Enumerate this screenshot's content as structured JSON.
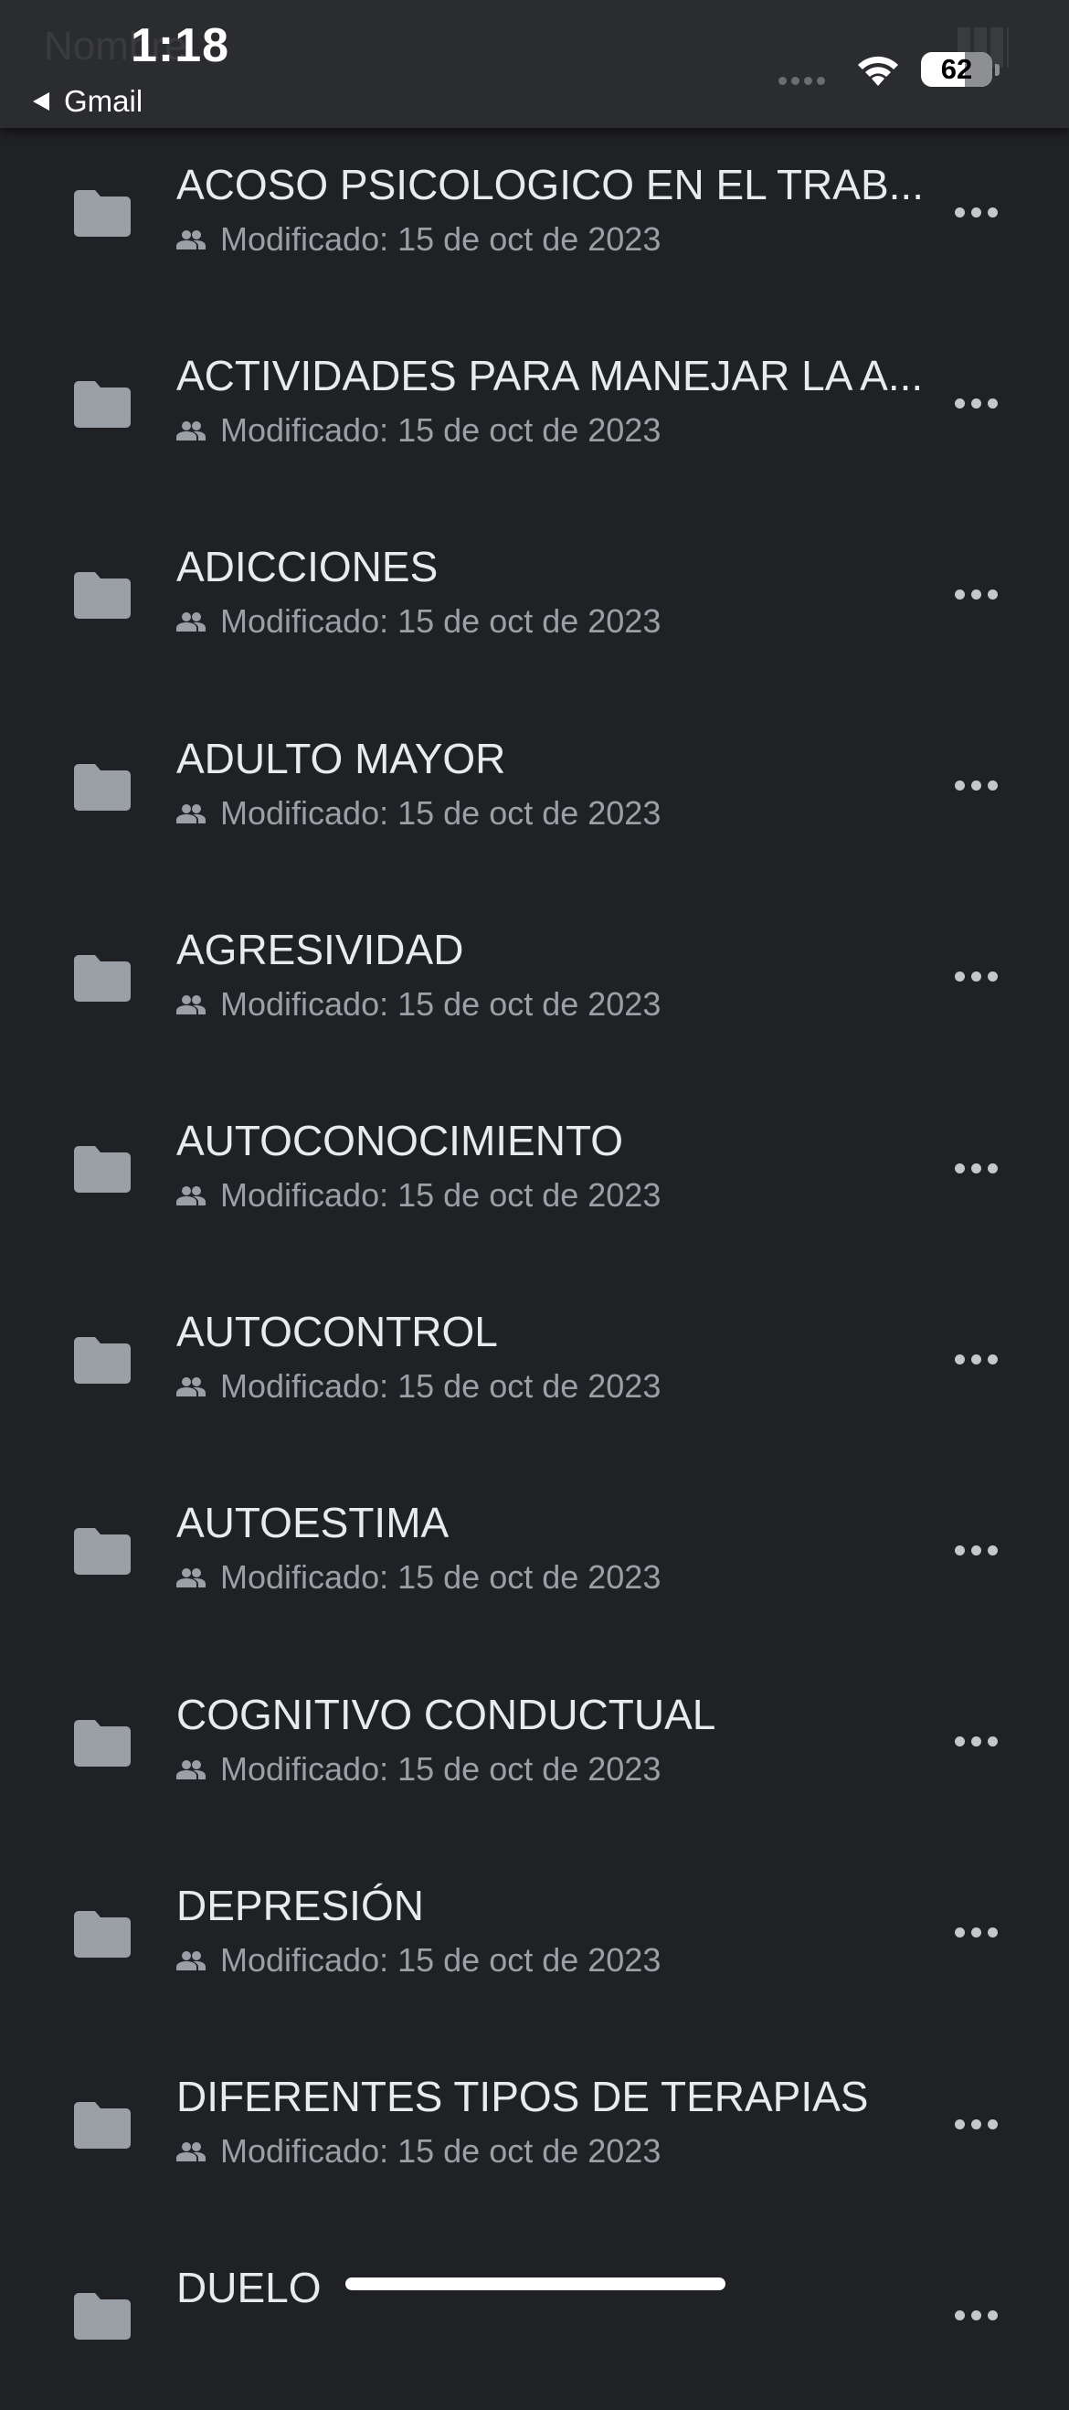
{
  "status_bar": {
    "time": "1:18",
    "back_app": "Gmail",
    "battery": "62",
    "ghost_title": "Nombre"
  },
  "colors": {
    "background": "#202124",
    "header": "#2b2c2f",
    "folder_icon": "#9aa0a6",
    "text_primary": "#e8eaed",
    "text_secondary": "#9aa0a6"
  },
  "folders": [
    {
      "name": "ACOSO PSICOLOGICO EN EL TRAB...",
      "meta": "Modificado: 15 de oct de 2023"
    },
    {
      "name": "ACTIVIDADES PARA MANEJAR LA A...",
      "meta": "Modificado: 15 de oct de 2023"
    },
    {
      "name": "ADICCIONES",
      "meta": "Modificado: 15 de oct de 2023"
    },
    {
      "name": "ADULTO MAYOR",
      "meta": "Modificado: 15 de oct de 2023"
    },
    {
      "name": "AGRESIVIDAD",
      "meta": "Modificado: 15 de oct de 2023"
    },
    {
      "name": "AUTOCONOCIMIENTO",
      "meta": "Modificado: 15 de oct de 2023"
    },
    {
      "name": "AUTOCONTROL",
      "meta": "Modificado: 15 de oct de 2023"
    },
    {
      "name": "AUTOESTIMA",
      "meta": "Modificado: 15 de oct de 2023"
    },
    {
      "name": "COGNITIVO CONDUCTUAL",
      "meta": "Modificado: 15 de oct de 2023"
    },
    {
      "name": "DEPRESIÓN",
      "meta": "Modificado: 15 de oct de 2023"
    },
    {
      "name": "DIFERENTES TIPOS DE TERAPIAS",
      "meta": "Modificado: 15 de oct de 2023"
    },
    {
      "name": "DUELO",
      "meta": ""
    }
  ]
}
